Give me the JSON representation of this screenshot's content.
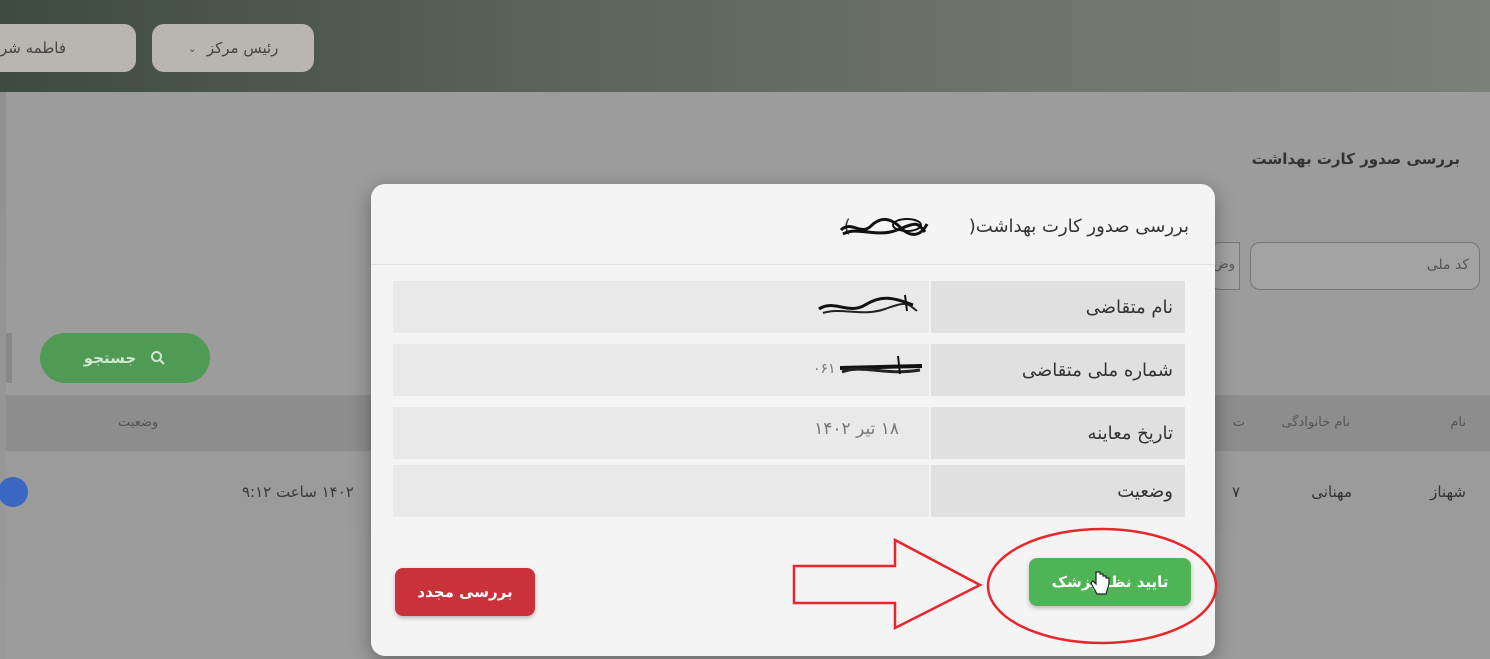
{
  "header": {
    "role_button": "رئیس مرکز",
    "user_button": "فاطمه شر"
  },
  "page": {
    "title": "بررسی صدور کارت بهداشت",
    "national_id_label": "کد ملی",
    "second_field_label": "وض",
    "search_button": "جستجو",
    "table": {
      "headers": {
        "first_name": "نام",
        "last_name": "نام خانوادگی",
        "status": "وضعیت",
        "partial": "ت"
      },
      "row": {
        "first_name": "شهناز",
        "last_name": "مهنانی",
        "partial": "۷",
        "datetime": "۱۴۰۲ ساعت ۹:۱۲"
      }
    }
  },
  "modal": {
    "title": "بررسی صدور کارت بهداشت(",
    "title_close": ")",
    "rows": {
      "name_label": "نام متقاضی",
      "national_label": "شماره ملی متقاضی",
      "national_value_prefix": "۰۶۱",
      "date_label": "تاریخ معاینه",
      "date_value": "۱۸ تیر ۱۴۰۲",
      "status_label": "وضعیت",
      "status_value": ""
    },
    "recheck_button": "بررسی مجدد",
    "approve_button": "تایید نظر پزشک"
  },
  "colors": {
    "approve": "#4fb455",
    "recheck": "#c9313b",
    "annotation": "#e8262b"
  },
  "icons": {
    "search": "search-icon",
    "chevron": "chevron-down-icon",
    "cursor": "hand-cursor-icon",
    "arrow": "arrow-right-annotation"
  }
}
